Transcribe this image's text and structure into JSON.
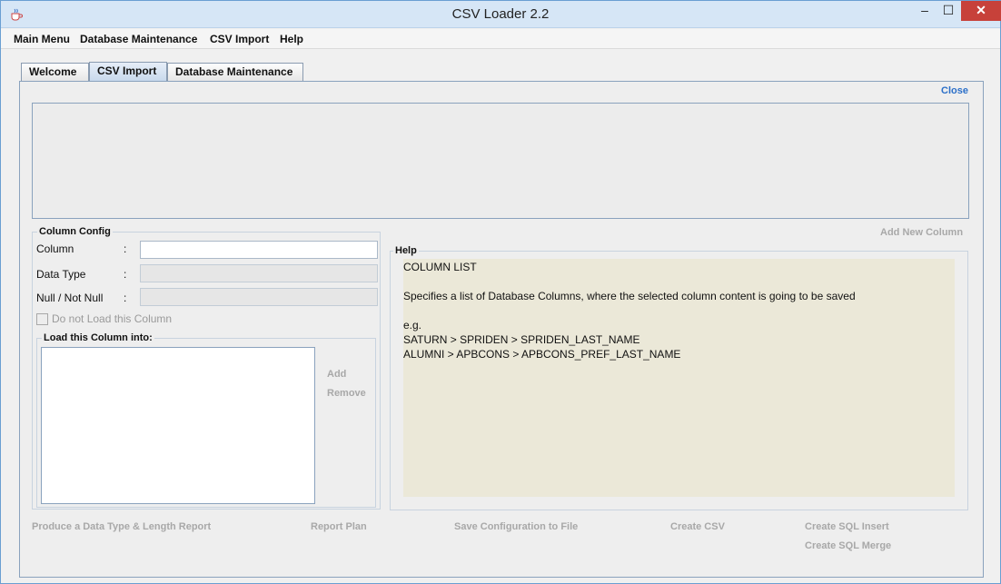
{
  "window": {
    "title": "CSV Loader 2.2",
    "app_icon": "java-cup-icon",
    "controls": {
      "minimize": "–",
      "maximize": "☐",
      "close": "✕"
    }
  },
  "menubar": [
    "Main Menu",
    "Database Maintenance",
    "CSV Import",
    "Help"
  ],
  "tabs": [
    "Welcome",
    "CSV Import",
    "Database Maintenance"
  ],
  "active_tab": "CSV Import",
  "panel": {
    "close_link": "Close",
    "add_new_column": "Add New Column",
    "column_config": {
      "legend": "Column Config",
      "column_label": "Column",
      "data_type_label": "Data Type",
      "null_label": "Null / Not Null",
      "colon": ":",
      "do_not_load_label": "Do not Load this Column",
      "load_into_legend": "Load this Column into:",
      "add_button": "Add",
      "remove_button": "Remove"
    },
    "help": {
      "legend": "Help",
      "lines": [
        "COLUMN LIST",
        "",
        "Specifies a list of Database Columns, where the selected column content is going to be saved",
        "",
        "e.g.",
        "SATURN > SPRIDEN > SPRIDEN_LAST_NAME",
        "ALUMNI > APBCONS > APBCONS_PREF_LAST_NAME"
      ]
    },
    "actions": {
      "produce_report": "Produce a Data Type & Length Report",
      "report_plan": "Report Plan",
      "save_config": "Save Configuration to File",
      "create_csv": "Create CSV",
      "create_sql_insert": "Create SQL Insert",
      "create_sql_merge": "Create SQL Merge"
    }
  },
  "colors": {
    "link": "#2b6fc8",
    "disabled_text": "#a8a8a8",
    "help_background": "#ebe8d8",
    "close_button": "#c7413a"
  }
}
